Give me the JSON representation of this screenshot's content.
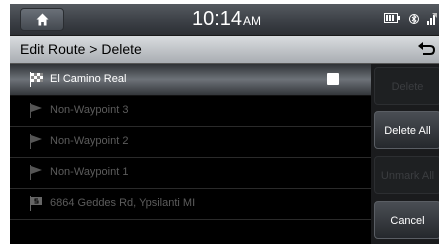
{
  "status": {
    "time": "10:14",
    "ampm": "AM"
  },
  "header": {
    "title": "Edit Route > Delete"
  },
  "route_list": [
    {
      "label": "El Camino Real",
      "icon": "finish-flag-icon",
      "selected": true,
      "checked": true
    },
    {
      "label": "Non-Waypoint 3",
      "icon": "waypoint-flag-icon",
      "selected": false
    },
    {
      "label": "Non-Waypoint 2",
      "icon": "waypoint-flag-icon",
      "selected": false
    },
    {
      "label": "Non-Waypoint 1",
      "icon": "waypoint-flag-icon",
      "selected": false
    },
    {
      "label": "6864 Geddes Rd, Ypsilanti MI",
      "icon": "start-flag-icon",
      "selected": false
    }
  ],
  "buttons": {
    "delete": "Delete",
    "delete_all": "Delete All",
    "unmark_all": "Unmark All",
    "cancel": "Cancel"
  },
  "colors": {
    "accent_selected": "#6d7278",
    "text_disabled": "#5c5c5c"
  }
}
